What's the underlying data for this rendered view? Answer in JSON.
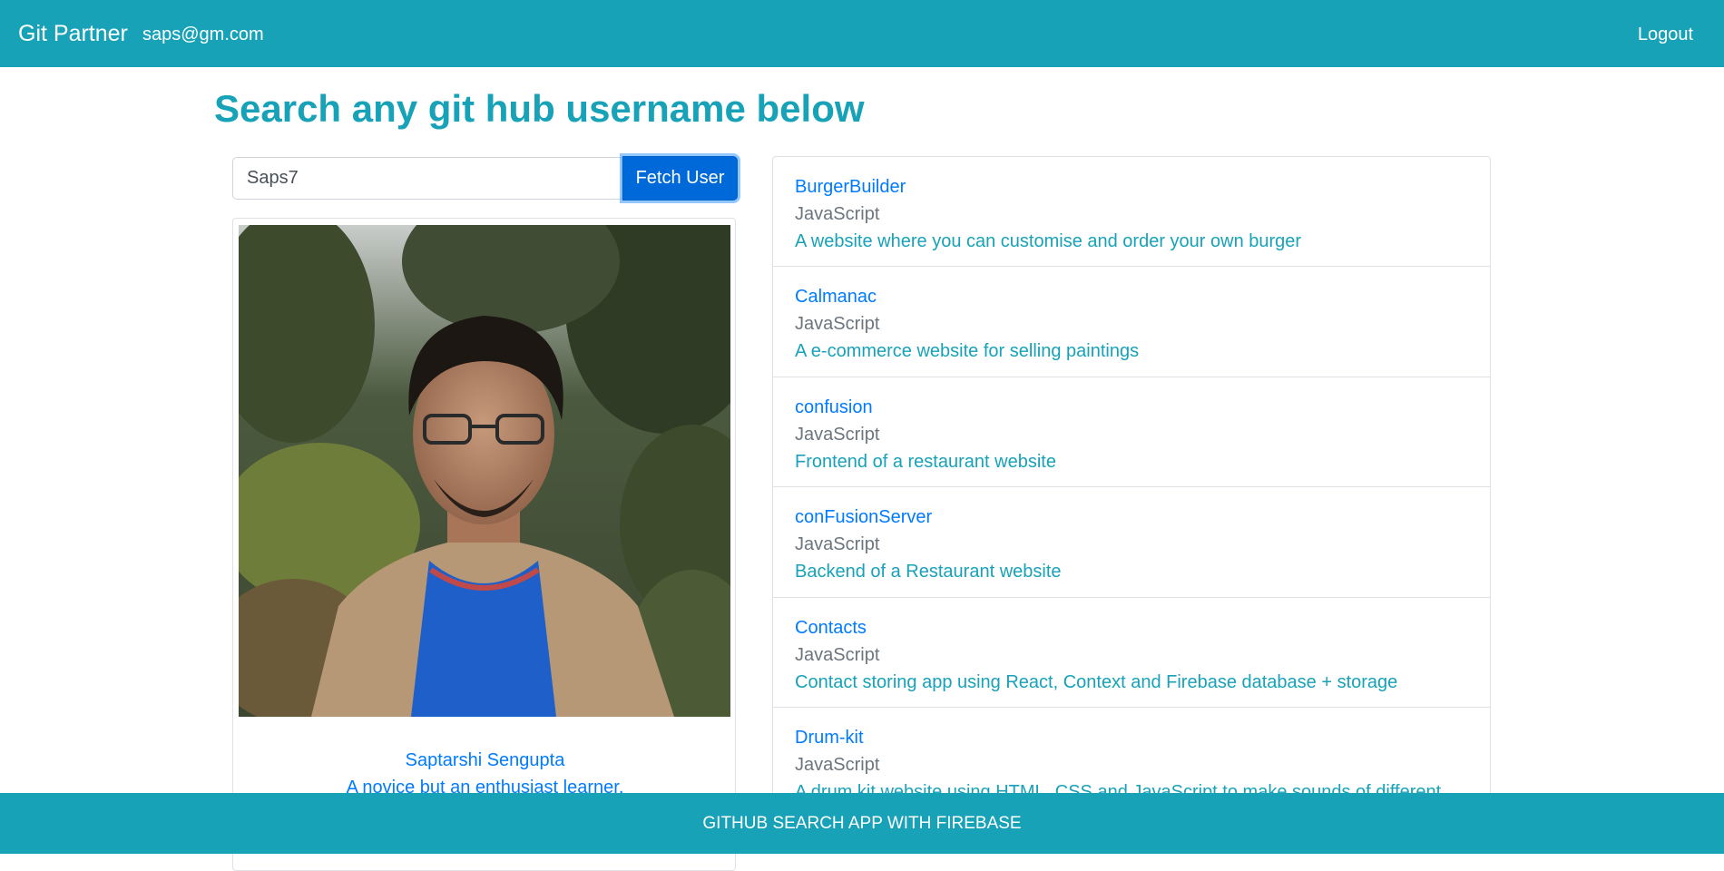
{
  "navbar": {
    "brand": "Git Partner",
    "user_email": "saps@gm.com",
    "logout_label": "Logout"
  },
  "page": {
    "title": "Search any git hub username below"
  },
  "search": {
    "value": "Saps7",
    "button_label": "Fetch User"
  },
  "profile": {
    "name": "Saptarshi Sengupta",
    "bio": "A novice but an enthusiast learner."
  },
  "repos": [
    {
      "name": "BurgerBuilder",
      "language": "JavaScript",
      "description": "A website where you can customise and order your own burger"
    },
    {
      "name": "Calmanac",
      "language": "JavaScript",
      "description": "A e-commerce website for selling paintings"
    },
    {
      "name": "confusion",
      "language": "JavaScript",
      "description": "Frontend of a restaurant website"
    },
    {
      "name": "conFusionServer",
      "language": "JavaScript",
      "description": "Backend of a Restaurant website"
    },
    {
      "name": "Contacts",
      "language": "JavaScript",
      "description": "Contact storing app using React, Context and Firebase database + storage"
    },
    {
      "name": "Drum-kit",
      "language": "JavaScript",
      "description": "A drum kit website using HTML, CSS and JavaScript to make sounds of different"
    }
  ],
  "footer": {
    "text": "GITHUB SEARCH APP WITH FIREBASE"
  },
  "colors": {
    "primary": "#17a2b8",
    "button": "#0069d9",
    "link": "#007bff",
    "muted": "#6c757d"
  },
  "icons": {
    "avatar": "user-photo"
  }
}
